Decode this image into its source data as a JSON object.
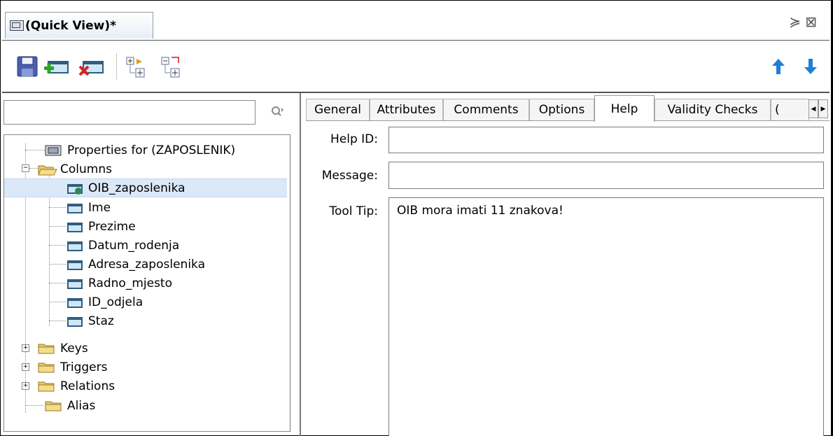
{
  "window": {
    "title": "(Quick View)*",
    "controls": "∨ ✗"
  },
  "toolbar": {
    "buttons": [
      "save-icon",
      "add-icon",
      "delete-icon",
      "expand-down-icon",
      "expand-up-icon"
    ],
    "nav": [
      "move-up-icon",
      "move-down-icon"
    ]
  },
  "search": {
    "value": "",
    "placeholder": ""
  },
  "tree": {
    "root": "Properties for (ZAPOSLENIK)",
    "columns_label": "Columns",
    "columns": [
      "OIB_zaposlenika",
      "Ime",
      "Prezime",
      "Datum_rodenja",
      "Adresa_zaposlenika",
      "Radno_mjesto",
      "ID_odjela",
      "Staz"
    ],
    "selected": "OIB_zaposlenika",
    "groups": [
      "Keys",
      "Triggers",
      "Relations",
      "Alias"
    ]
  },
  "tabs": [
    "General",
    "Attributes",
    "Comments",
    "Options",
    "Help",
    "Validity Checks",
    "("
  ],
  "active_tab": "Help",
  "form": {
    "help_id_label": "Help ID:",
    "help_id_value": "",
    "message_label": "Message:",
    "message_value": "",
    "tooltip_label": "Tool Tip:",
    "tooltip_value": "OIB mora imati 11 znakova!"
  },
  "colors": {
    "selection": "#dbe8f7",
    "arrow_blue": "#1e7fd6",
    "folder": "#e8c96a"
  }
}
